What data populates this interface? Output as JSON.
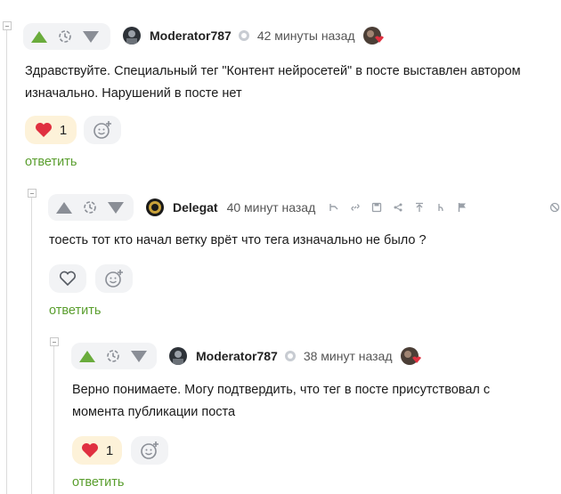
{
  "comments": [
    {
      "author": "Moderator787",
      "time": "42 минуты назад",
      "lines": [
        "Здравствуйте. Специальный тег \"Контент нейросетей\" в посте выставлен автором",
        "изначально. Нарушений в посте нет"
      ],
      "reaction_count": "1",
      "reply": "ответить"
    },
    {
      "author": "Delegat",
      "time": "40 минут назад",
      "lines": [
        "тоесть тот кто начал ветку врёт что тега изначально не было ?"
      ],
      "reply": "ответить"
    },
    {
      "author": "Moderator787",
      "time": "38 минут назад",
      "lines": [
        "Верно понимаете. Могу подтвердить, что тег в посте присутствовал с",
        "момента публикации поста"
      ],
      "reaction_count": "1",
      "reply": "ответить"
    }
  ],
  "colors": {
    "upvote_active": "#6aac3c",
    "vote_icon": "#8a8e96",
    "heart": "#e03040",
    "reply_link": "#5a9e2e",
    "reaction_active_bg": "#fdf2d9"
  },
  "icons": [
    "collapse-icon",
    "upvote-icon",
    "clock-icon",
    "downvote-icon",
    "avatar",
    "moderator-badge-icon",
    "heart-icon",
    "add-reaction-icon",
    "reply-branch-icon",
    "link-icon",
    "save-icon",
    "share-icon",
    "pin-icon",
    "mention-icon",
    "flag-icon",
    "hide-icon"
  ]
}
